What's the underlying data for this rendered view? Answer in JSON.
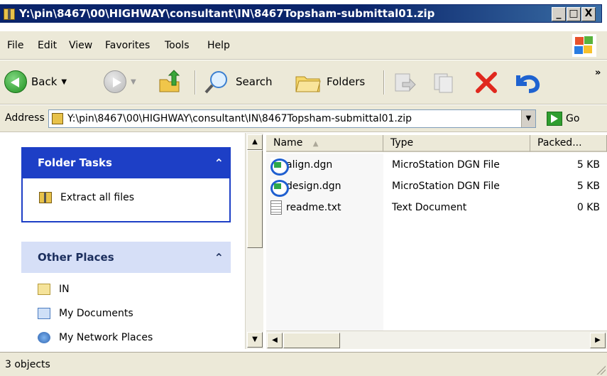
{
  "window": {
    "title": "Y:\\pin\\8467\\00\\HIGHWAY\\consultant\\IN\\8467Topsham-submittal01.zip",
    "minimize": "_",
    "maximize": "□",
    "close": "X"
  },
  "menu": {
    "items": [
      "File",
      "Edit",
      "View",
      "Favorites",
      "Tools",
      "Help"
    ]
  },
  "toolbar": {
    "back_label": "Back",
    "search_label": "Search",
    "folders_label": "Folders",
    "overflow": "»"
  },
  "address": {
    "label": "Address",
    "value": "Y:\\pin\\8467\\00\\HIGHWAY\\consultant\\IN\\8467Topsham-submittal01.zip",
    "go_label": "Go"
  },
  "tasks": {
    "folder_tasks": {
      "title": "Folder Tasks",
      "items": [
        {
          "label": "Extract all files",
          "icon": "zip-folder-icon"
        }
      ]
    },
    "other_places": {
      "title": "Other Places",
      "items": [
        {
          "label": "IN",
          "icon": "folder-icon"
        },
        {
          "label": "My Documents",
          "icon": "my-documents-icon"
        },
        {
          "label": "My Network Places",
          "icon": "network-places-icon"
        }
      ]
    },
    "collapse_glyph": "⌃"
  },
  "filelist": {
    "columns": {
      "name": "Name",
      "type": "Type",
      "packed": "Packed..."
    },
    "sort_indicator": "▲",
    "files": [
      {
        "name": "align.dgn",
        "type": "MicroStation DGN File",
        "size": "5 KB",
        "icon": "dgn-file-icon"
      },
      {
        "name": "design.dgn",
        "type": "MicroStation DGN File",
        "size": "5 KB",
        "icon": "dgn-file-icon"
      },
      {
        "name": "readme.txt",
        "type": "Text Document",
        "size": "0 KB",
        "icon": "text-file-icon"
      }
    ]
  },
  "status": {
    "text": "3 objects"
  },
  "colors": {
    "titlebar": "#0a246a",
    "task_header": "#1d3fc6",
    "task_header_text": "#ffffff",
    "other_header": "#d6dff7"
  }
}
